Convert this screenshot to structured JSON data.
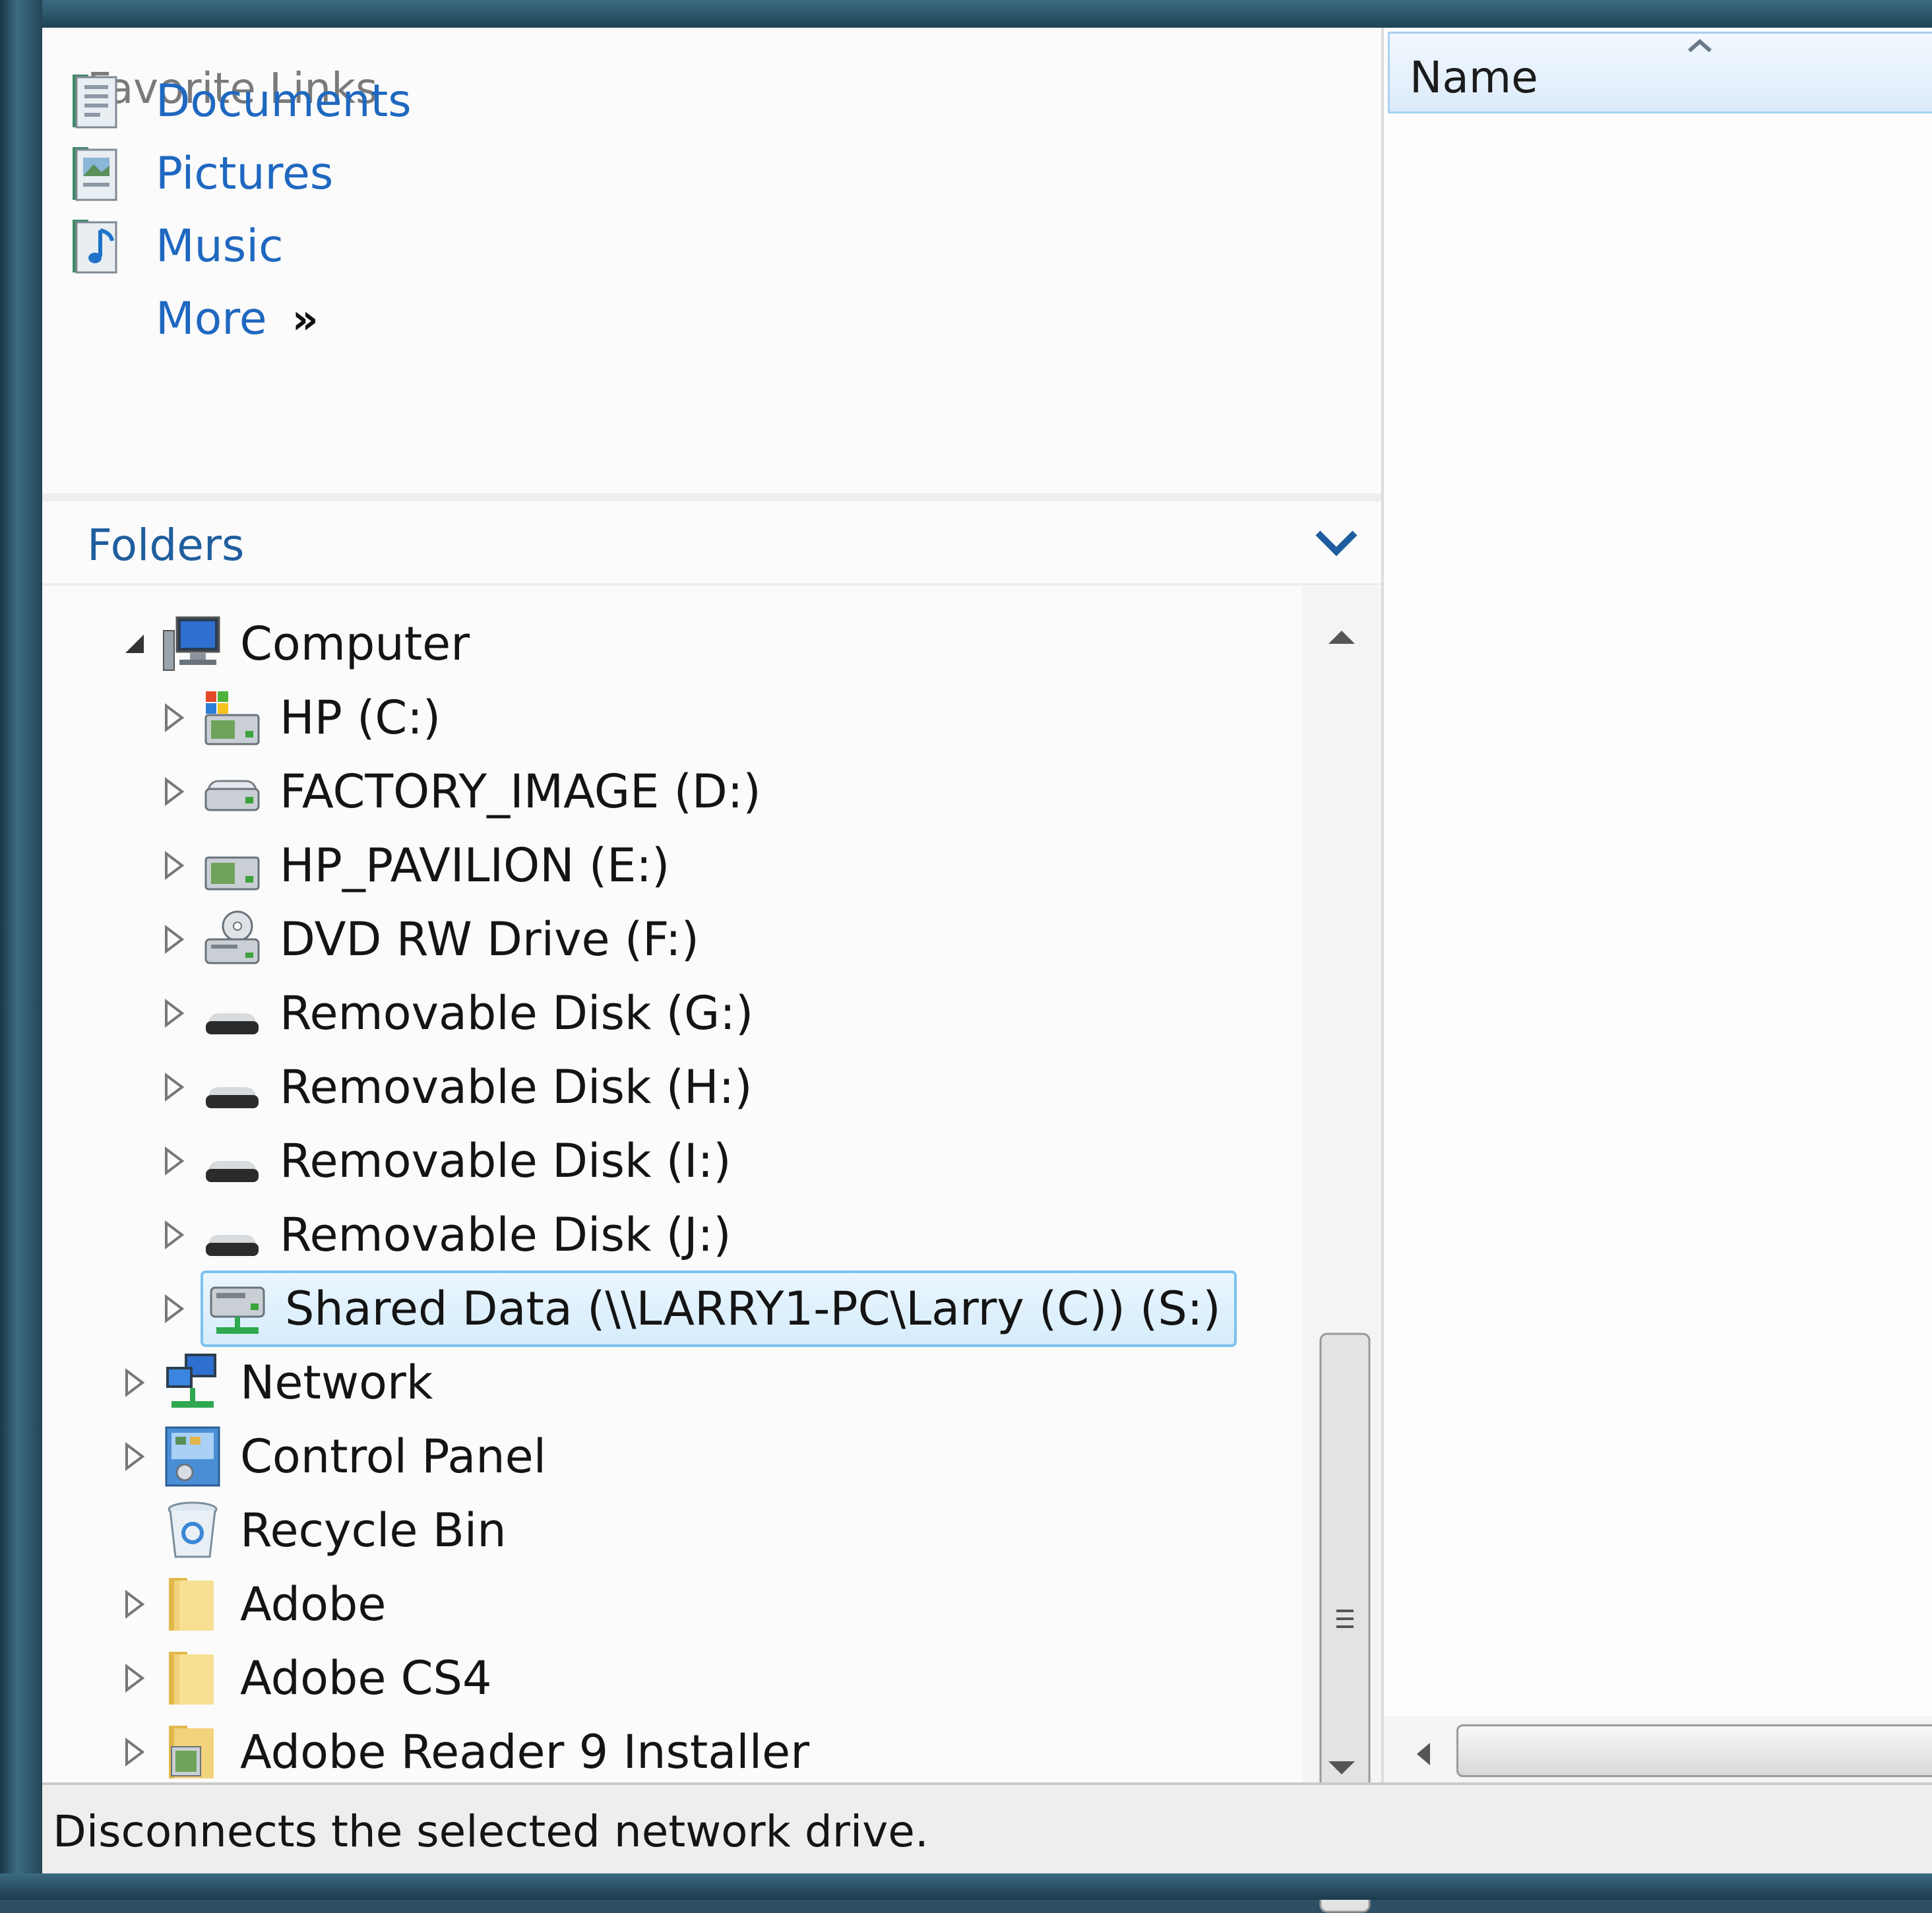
{
  "favorite_links": {
    "title": "Favorite Links",
    "items": [
      {
        "label": "Documents",
        "icon": "documents-icon"
      },
      {
        "label": "Pictures",
        "icon": "pictures-icon"
      },
      {
        "label": "Music",
        "icon": "music-icon"
      }
    ],
    "more_label": "More",
    "more_glyph": "»"
  },
  "folders": {
    "title": "Folders",
    "tree": [
      {
        "label": "Computer",
        "icon": "computer-icon",
        "expanded": true
      },
      {
        "label": "HP (C:)",
        "icon": "system-drive-icon"
      },
      {
        "label": "FACTORY_IMAGE (D:)",
        "icon": "hard-drive-icon"
      },
      {
        "label": "HP_PAVILION (E:)",
        "icon": "drive-icon"
      },
      {
        "label": "DVD RW Drive (F:)",
        "icon": "dvd-drive-icon"
      },
      {
        "label": "Removable Disk (G:)",
        "icon": "removable-disk-icon"
      },
      {
        "label": "Removable Disk (H:)",
        "icon": "removable-disk-icon"
      },
      {
        "label": "Removable Disk (I:)",
        "icon": "removable-disk-icon"
      },
      {
        "label": "Removable Disk (J:)",
        "icon": "removable-disk-icon"
      },
      {
        "label": "Shared Data (\\\\LARRY1-PC\\Larry (C)) (S:)",
        "icon": "network-drive-icon",
        "selected": true
      },
      {
        "label": "Network",
        "icon": "network-icon"
      },
      {
        "label": "Control Panel",
        "icon": "control-panel-icon"
      },
      {
        "label": "Recycle Bin",
        "icon": "recycle-bin-icon"
      },
      {
        "label": "Adobe",
        "icon": "folder-icon"
      },
      {
        "label": "Adobe CS4",
        "icon": "folder-icon"
      },
      {
        "label": "Adobe Reader 9 Installer",
        "icon": "installer-folder-icon"
      }
    ]
  },
  "file_list": {
    "column_header": "Name",
    "sort": "ascending"
  },
  "status_bar": {
    "text": "Disconnects the selected network drive."
  },
  "colors": {
    "link_blue": "#1f68c0",
    "selection_border": "#7dc2f0",
    "selection_fill": "#d6ecfc",
    "frame": "#2d4f63"
  }
}
